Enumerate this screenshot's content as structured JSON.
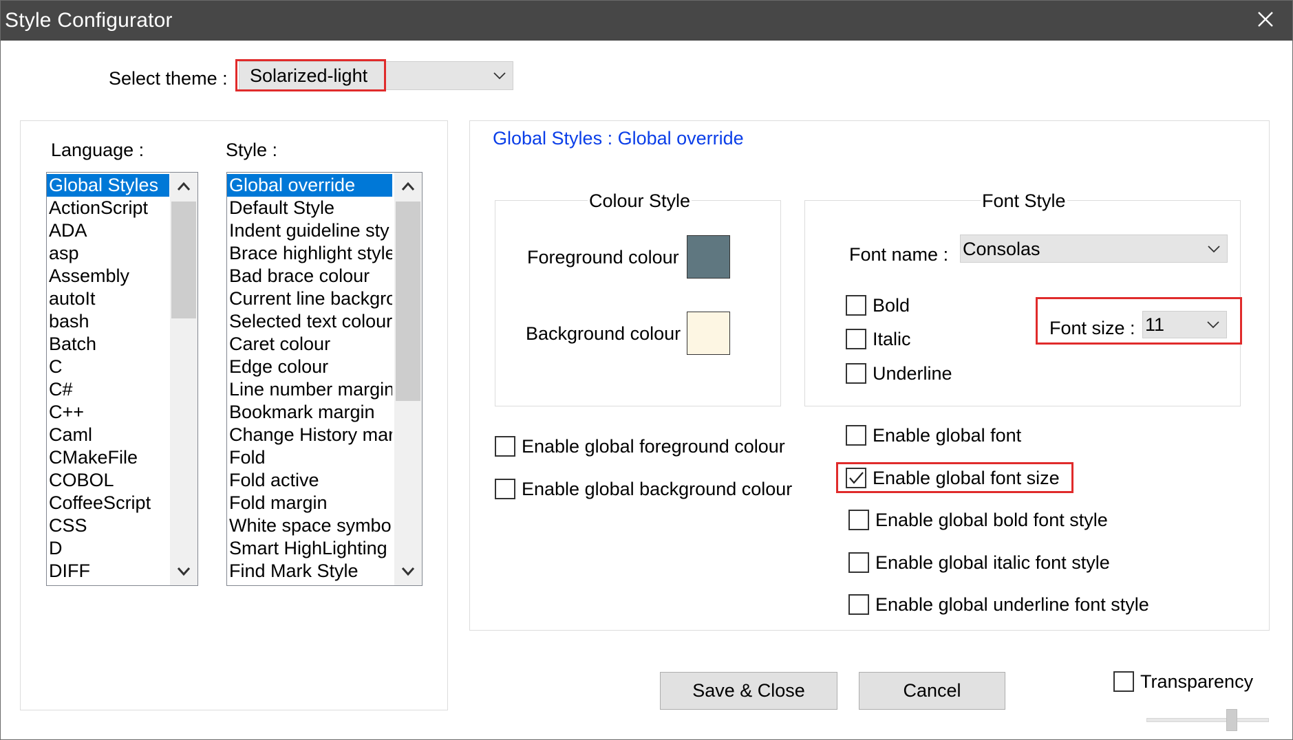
{
  "window": {
    "title": "Style Configurator"
  },
  "theme": {
    "label": "Select theme :",
    "value": "Solarized-light"
  },
  "language": {
    "label": "Language :",
    "items": [
      "Global Styles",
      "ActionScript",
      "ADA",
      "asp",
      "Assembly",
      "autoIt",
      "bash",
      "Batch",
      "C",
      "C#",
      "C++",
      "Caml",
      "CMakeFile",
      "COBOL",
      "CoffeeScript",
      "CSS",
      "D",
      "DIFF"
    ],
    "selected_index": 0
  },
  "style": {
    "label": "Style :",
    "items": [
      "Global override",
      "Default Style",
      "Indent guideline sty",
      "Brace highlight style",
      "Bad brace colour",
      "Current line backgro",
      "Selected text colour",
      "Caret colour",
      "Edge colour",
      "Line number margin",
      "Bookmark margin",
      "Change History mar",
      "Fold",
      "Fold active",
      "Fold margin",
      "White space symbol",
      "Smart HighLighting",
      "Find Mark Style"
    ],
    "selected_index": 0
  },
  "details": {
    "heading": "Global Styles : Global override"
  },
  "colour_style": {
    "title": "Colour Style",
    "foreground_label": "Foreground colour",
    "foreground_color": "#5f7780",
    "background_label": "Background colour",
    "background_color": "#fdf6e3"
  },
  "font_style": {
    "title": "Font Style",
    "font_name_label": "Font name :",
    "font_name_value": "Consolas",
    "bold_label": "Bold",
    "italic_label": "Italic",
    "underline_label": "Underline",
    "font_size_label": "Font size :",
    "font_size_value": "11"
  },
  "global_options": {
    "enable_fg": "Enable global foreground colour",
    "enable_bg": "Enable global background colour",
    "enable_font": "Enable global font",
    "enable_font_size": "Enable global font size",
    "enable_bold": "Enable global bold font style",
    "enable_italic": "Enable global italic font style",
    "enable_underline": "Enable global underline font style"
  },
  "checked": {
    "enable_font_size": true
  },
  "buttons": {
    "save_close": "Save & Close",
    "cancel": "Cancel"
  },
  "transparency": {
    "label": "Transparency"
  },
  "colors": {
    "titlebar": "#474747",
    "selection": "#0078d7",
    "highlight_box": "#e02b2b",
    "heading_blue": "#0a3ee8"
  },
  "icons": {
    "close": "close-icon",
    "dropdown": "chevron-down-icon",
    "scroll_up": "chevron-up-icon",
    "scroll_down": "chevron-down-icon",
    "check": "checkmark-icon"
  }
}
